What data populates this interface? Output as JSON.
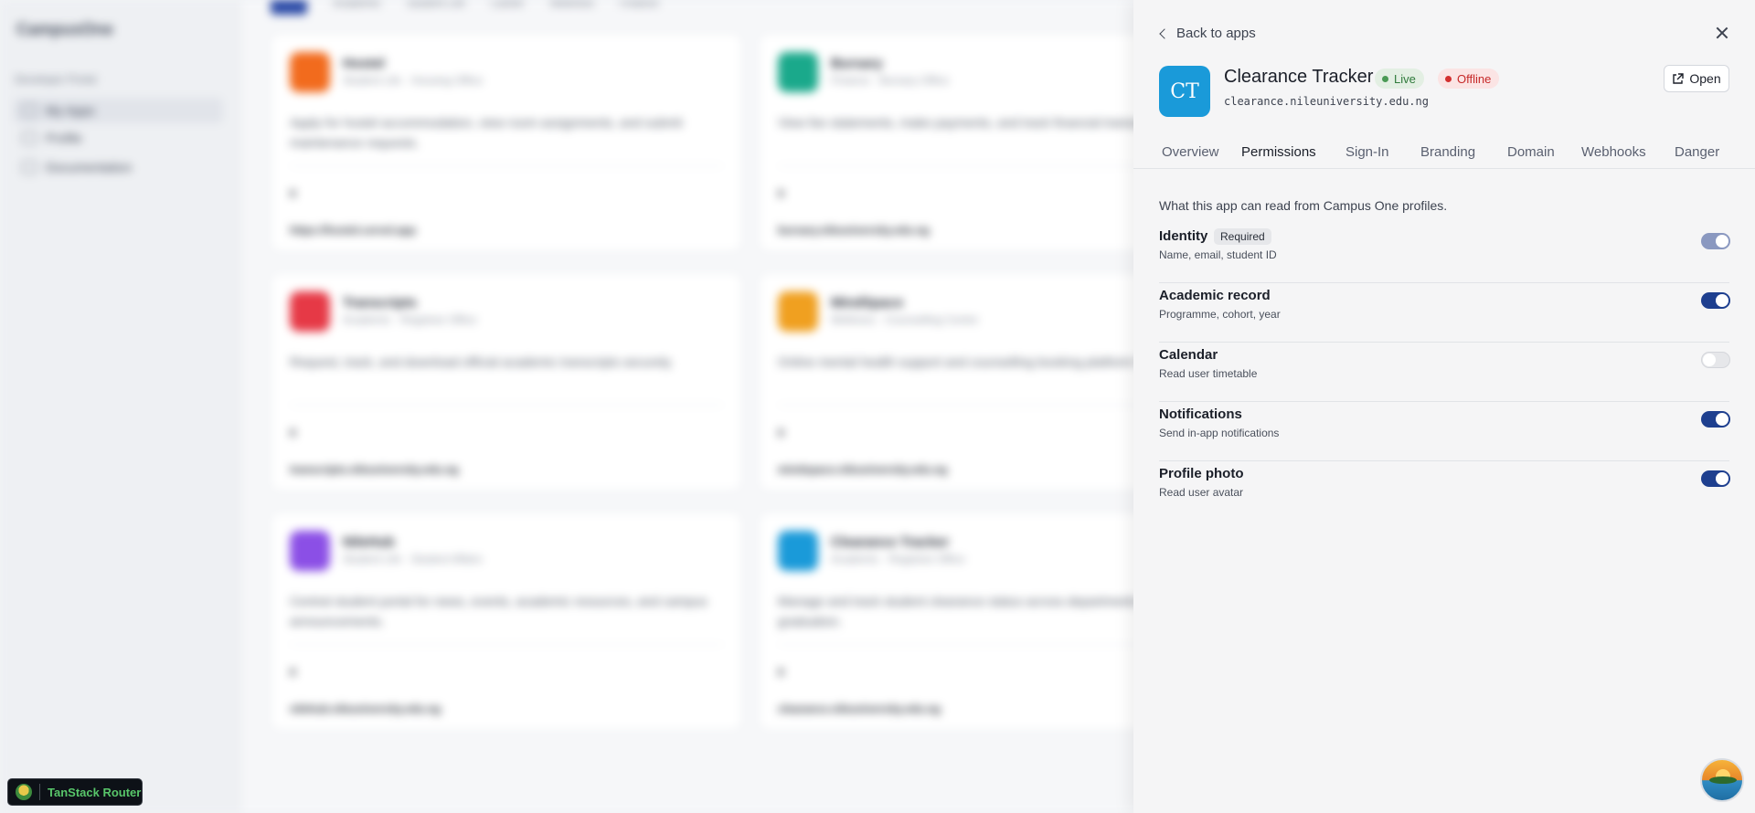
{
  "background": {
    "portal_name": "CampusOne",
    "section_label": "Developer Portal",
    "nav": [
      "My Apps",
      "Profile",
      "Documentation"
    ],
    "tabs": [
      "Academic",
      "Student Life",
      "Career",
      "Wellness",
      "Finance"
    ],
    "cards": [
      {
        "title": "Hostel",
        "subtitle": "Student Life · Housing Office",
        "desc": "Apply for hostel accommodation, view room assignments, and submit maintenance requests.",
        "color": "#f26b1d",
        "users": "0",
        "endpoint": "https://hostel.cervel.app"
      },
      {
        "title": "Bursary",
        "subtitle": "Finance · Bursary Office",
        "desc": "View fee statements, make payments, and track financial transactions.",
        "color": "#1aa98b",
        "users": "0",
        "endpoint": "bursary.nileuniversity.edu.ng"
      },
      {
        "title": "Transcripts",
        "subtitle": "Academic · Registrar Office",
        "desc": "Request, track, and download official academic transcripts securely.",
        "color": "#e63946",
        "users": "0",
        "endpoint": "transcripts.nileuniversity.edu.ng"
      },
      {
        "title": "MindSpace",
        "subtitle": "Wellness · Counselling Centre",
        "desc": "Online mental health support and counselling booking platform for students.",
        "color": "#f0a020",
        "users": "0",
        "endpoint": "mindspace.nileuniversity.edu.ng"
      },
      {
        "title": "NileHub",
        "subtitle": "Student Life · Student Affairs",
        "desc": "Central student portal for news, events, academic resources, and campus announcements.",
        "color": "#8b4fe6",
        "users": "0",
        "endpoint": "nilehub.nileuniversity.edu.ng"
      },
      {
        "title": "Clearance Tracker",
        "subtitle": "Academic · Registrar Office",
        "desc": "Manage and track student clearance status across departments before graduation.",
        "color": "#1a9ad9",
        "users": "0",
        "endpoint": "clearance.nileuniversity.edu.ng"
      }
    ]
  },
  "drawer": {
    "back_label": "Back to apps",
    "app": {
      "initials": "CT",
      "title": "Clearance Tracker",
      "status_live": "Live",
      "status_offline": "Offline",
      "domain": "clearance.nileuniversity.edu.ng",
      "open_label": "Open"
    },
    "tabs": [
      "Overview",
      "Permissions",
      "Sign-In",
      "Branding",
      "Domain",
      "Webhooks",
      "Danger"
    ],
    "active_tab": "Permissions",
    "permissions_intro": "What this app can read from Campus One profiles.",
    "permissions": [
      {
        "name": "Identity",
        "desc": "Name, email, student ID",
        "required_label": "Required",
        "enabled": true
      },
      {
        "name": "Academic record",
        "desc": "Programme, cohort, year",
        "enabled": true
      },
      {
        "name": "Calendar",
        "desc": "Read user timetable",
        "enabled": false
      },
      {
        "name": "Notifications",
        "desc": "Send in-app notifications",
        "enabled": true
      },
      {
        "name": "Profile photo",
        "desc": "Read user avatar",
        "enabled": true
      }
    ]
  },
  "devtools": {
    "label": "TanStack Router"
  },
  "colors": {
    "accent": "#1e3f8f",
    "live": "#2f7a3b",
    "offline": "#c62828",
    "app_icon": "#1a9ad9"
  }
}
